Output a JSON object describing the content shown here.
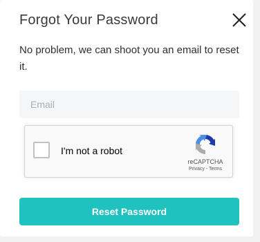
{
  "modal": {
    "title": "Forgot Your Password",
    "description": "No problem, we can shoot you an email to reset it.",
    "close_icon": "close-icon"
  },
  "email": {
    "placeholder": "Email",
    "value": ""
  },
  "recaptcha": {
    "label": "I'm not a robot",
    "brand": "reCAPTCHA",
    "privacy": "Privacy",
    "separator": " - ",
    "terms": "Terms",
    "logo_icon": "recaptcha-logo-icon"
  },
  "submit": {
    "label": "Reset Password"
  },
  "colors": {
    "accent": "#1fc2be",
    "input_bg": "#f5f6f8",
    "title_text": "#3a3a3a"
  }
}
